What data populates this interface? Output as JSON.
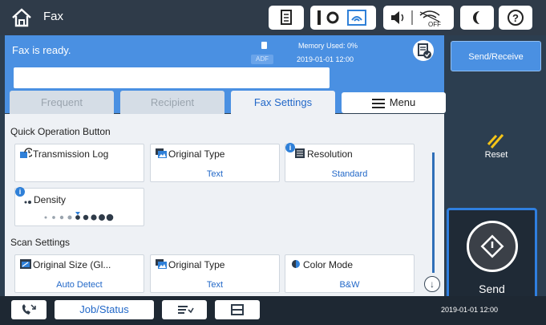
{
  "header": {
    "title": "Fax",
    "icons": [
      "home-icon",
      "document-icon",
      "wifi-direct-icon",
      "wifi-icon",
      "volume-icon",
      "wifi-off-icon",
      "sleep-icon",
      "help-icon"
    ]
  },
  "status": {
    "message": "Fax is ready.",
    "adf_label": "ADF",
    "memory": "Memory Used: 0%",
    "datetime": "2019-01-01 12:00"
  },
  "number_field": {
    "value": "",
    "placeholder": ""
  },
  "tabs": [
    {
      "label": "Frequent",
      "active": false
    },
    {
      "label": "Recipient",
      "active": false
    },
    {
      "label": "Fax Settings",
      "active": true
    },
    {
      "label": "Menu",
      "active": false
    }
  ],
  "quick_operation": {
    "title": "Quick Operation Button",
    "cards": [
      {
        "label": "Transmission Log",
        "value": ""
      },
      {
        "label": "Original Type",
        "value": "Text"
      },
      {
        "label": "Resolution",
        "value": "Standard"
      },
      {
        "label": "Density",
        "value": ""
      }
    ],
    "density_level": 5,
    "density_steps": 9
  },
  "scan_settings": {
    "title": "Scan Settings",
    "cards": [
      {
        "label": "Original Size (Gl...",
        "value": "Auto Detect"
      },
      {
        "label": "Original Type",
        "value": "Text"
      },
      {
        "label": "Color Mode",
        "value": "B&W"
      }
    ]
  },
  "right_panel": {
    "send_receive": "Send/Receive",
    "reset": "Reset",
    "send": "Send"
  },
  "bottom": {
    "job_status": "Job/Status",
    "datetime": "2019-01-01 12:00"
  },
  "colors": {
    "accent": "#4a90e2",
    "header": "#2f3b49",
    "active_tab_text": "#2268c8"
  }
}
